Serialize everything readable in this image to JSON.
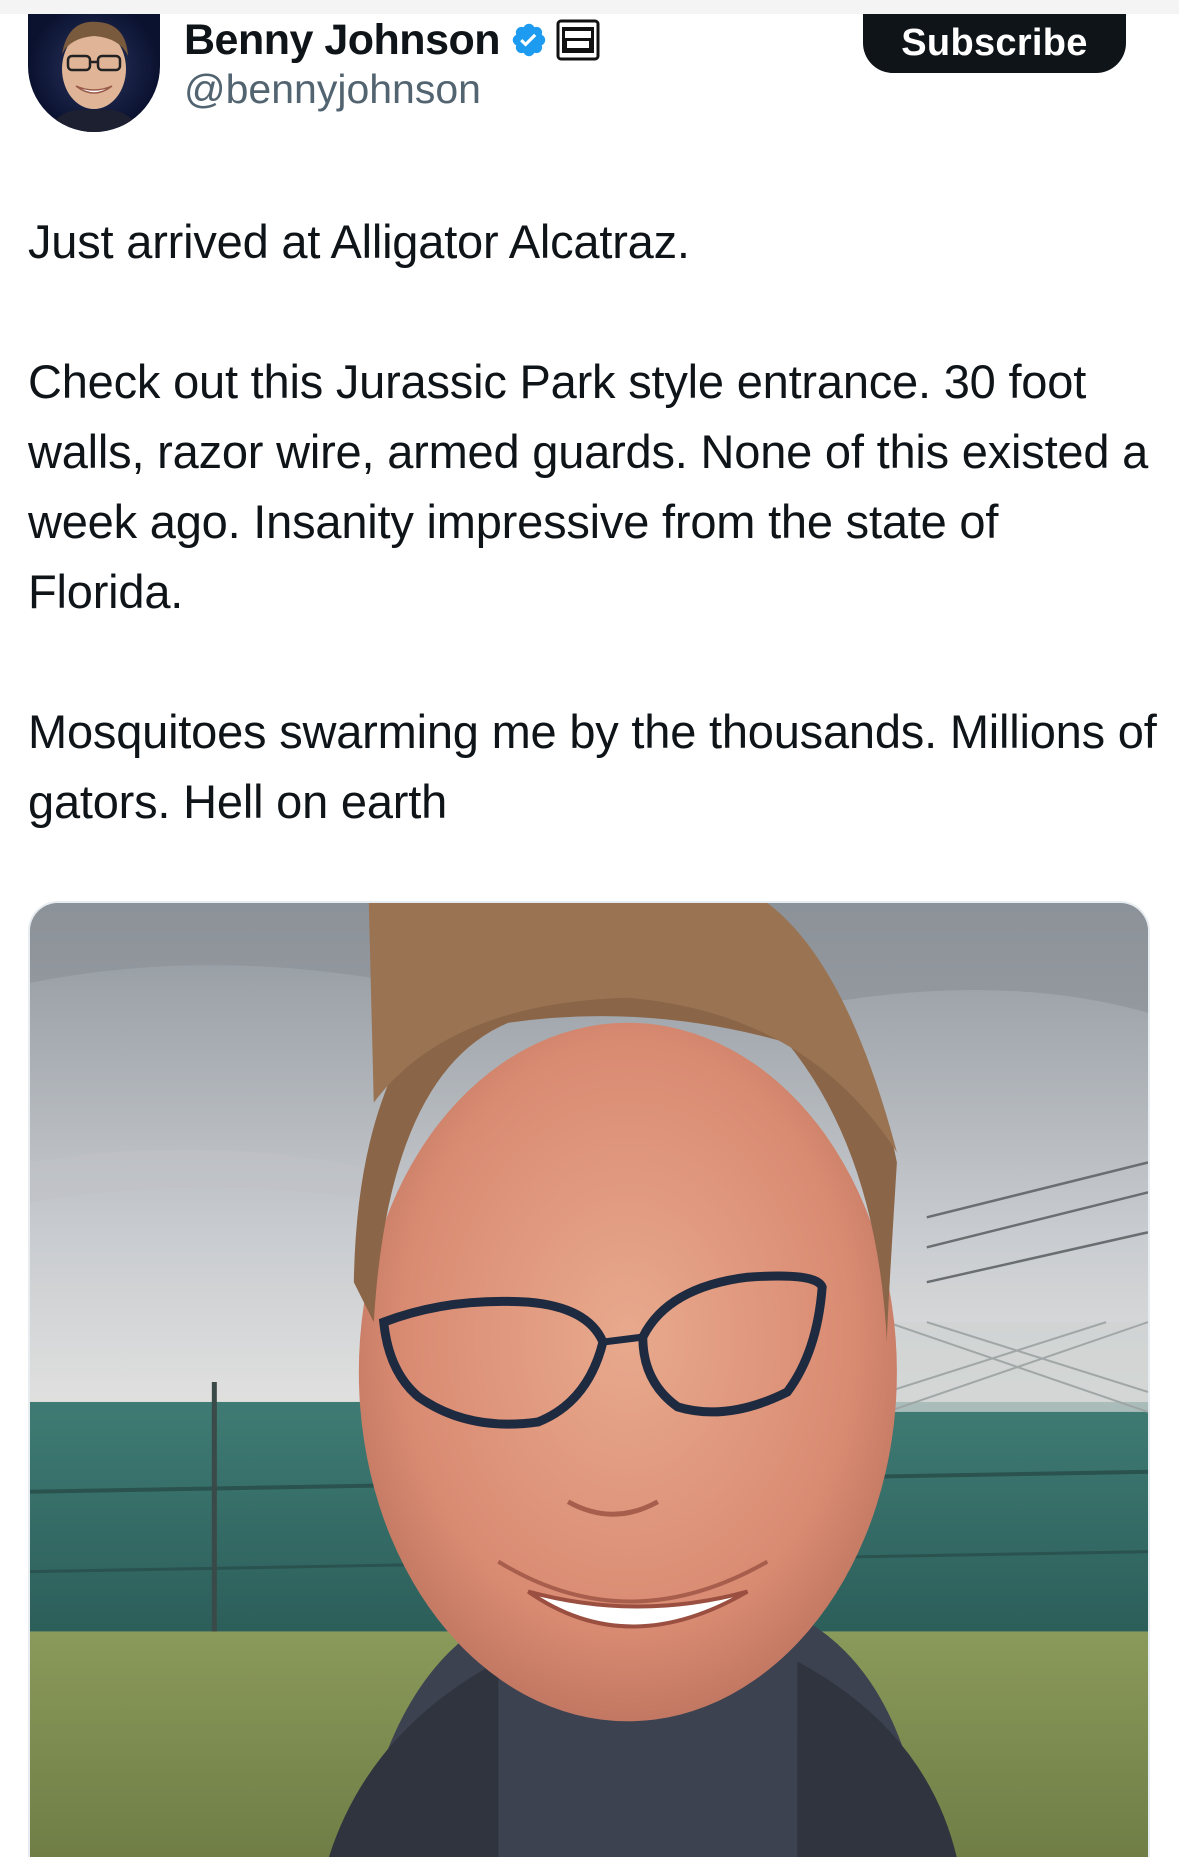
{
  "author": {
    "display_name": "Benny Johnson",
    "handle": "@bennyjohnson",
    "verified_icon": "verified-badge-icon",
    "affiliate_icon": "benny-show-badge-icon"
  },
  "actions": {
    "subscribe_label": "Subscribe"
  },
  "tweet": {
    "paragraphs": [
      "Just arrived at Alligator Alcatraz.",
      "Check out this Jurassic Park style entrance. 30 foot walls, razor wire, armed guards. None of this existed a week ago. Insanity impressive from the state of Florida.",
      "Mosquitoes swarming me by the thousands. Millions of gators. Hell on earth"
    ]
  },
  "media": {
    "type": "video-thumbnail",
    "description_icon": "selfie-video-frame"
  },
  "colors": {
    "text": "#0f1419",
    "secondary_text": "#536471",
    "verified_blue": "#1d9bf0",
    "button_bg": "#0f1419"
  }
}
